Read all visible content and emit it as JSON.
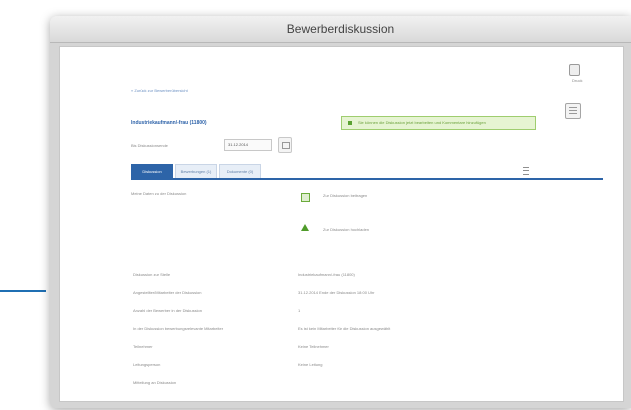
{
  "window": {
    "title": "Bewerberdiskussion"
  },
  "header": {
    "back_link": "« Zurück zur Bewerberübersicht",
    "page_title": "Industriekaufmann/-frau (11800)",
    "date_label": "Bis Diskussionsende",
    "date_value": "31.12.2014"
  },
  "notice": "Sie können die Diskussion jetzt bearbeiten und Kommentare hinzufügen",
  "tools": {
    "top_icon_label": "Druck"
  },
  "tabs": [
    {
      "label": "Diskussion",
      "active": true
    },
    {
      "label": "Bewerbungen (1)",
      "active": false
    },
    {
      "label": "Dokumente (0)",
      "active": false
    }
  ],
  "section": {
    "label": "Meine Daten zu der Diskussion",
    "actions": [
      {
        "label": "Zur Diskussion beitragen",
        "icon": "document-icon"
      },
      {
        "label": "Zur Diskussion hochladen",
        "icon": "upload-icon"
      }
    ]
  },
  "rows": [
    {
      "label": "Diskussion zur Stelle",
      "value": "Industriekaufmann/-frau (11800)"
    },
    {
      "label": "Angestellter/Mitarbeiter der Diskussion",
      "value": "31.12.2014 Ende der Diskussion 18:00 Uhr"
    },
    {
      "label": "Anzahl der Bewerber in der Diskussion",
      "value": "1"
    },
    {
      "label": "In der Diskussion bewerbungsrelevante Mitarbeiter",
      "value": "Es ist kein Mitarbeiter für die Diskussion ausgewählt"
    },
    {
      "label": "Teilnehmer",
      "value": "Keine Teilnehmer"
    },
    {
      "label": "Leitungsperson",
      "value": "Keine Leitung"
    },
    {
      "label": "Mitteilung an Diskussion",
      "value": ""
    }
  ]
}
